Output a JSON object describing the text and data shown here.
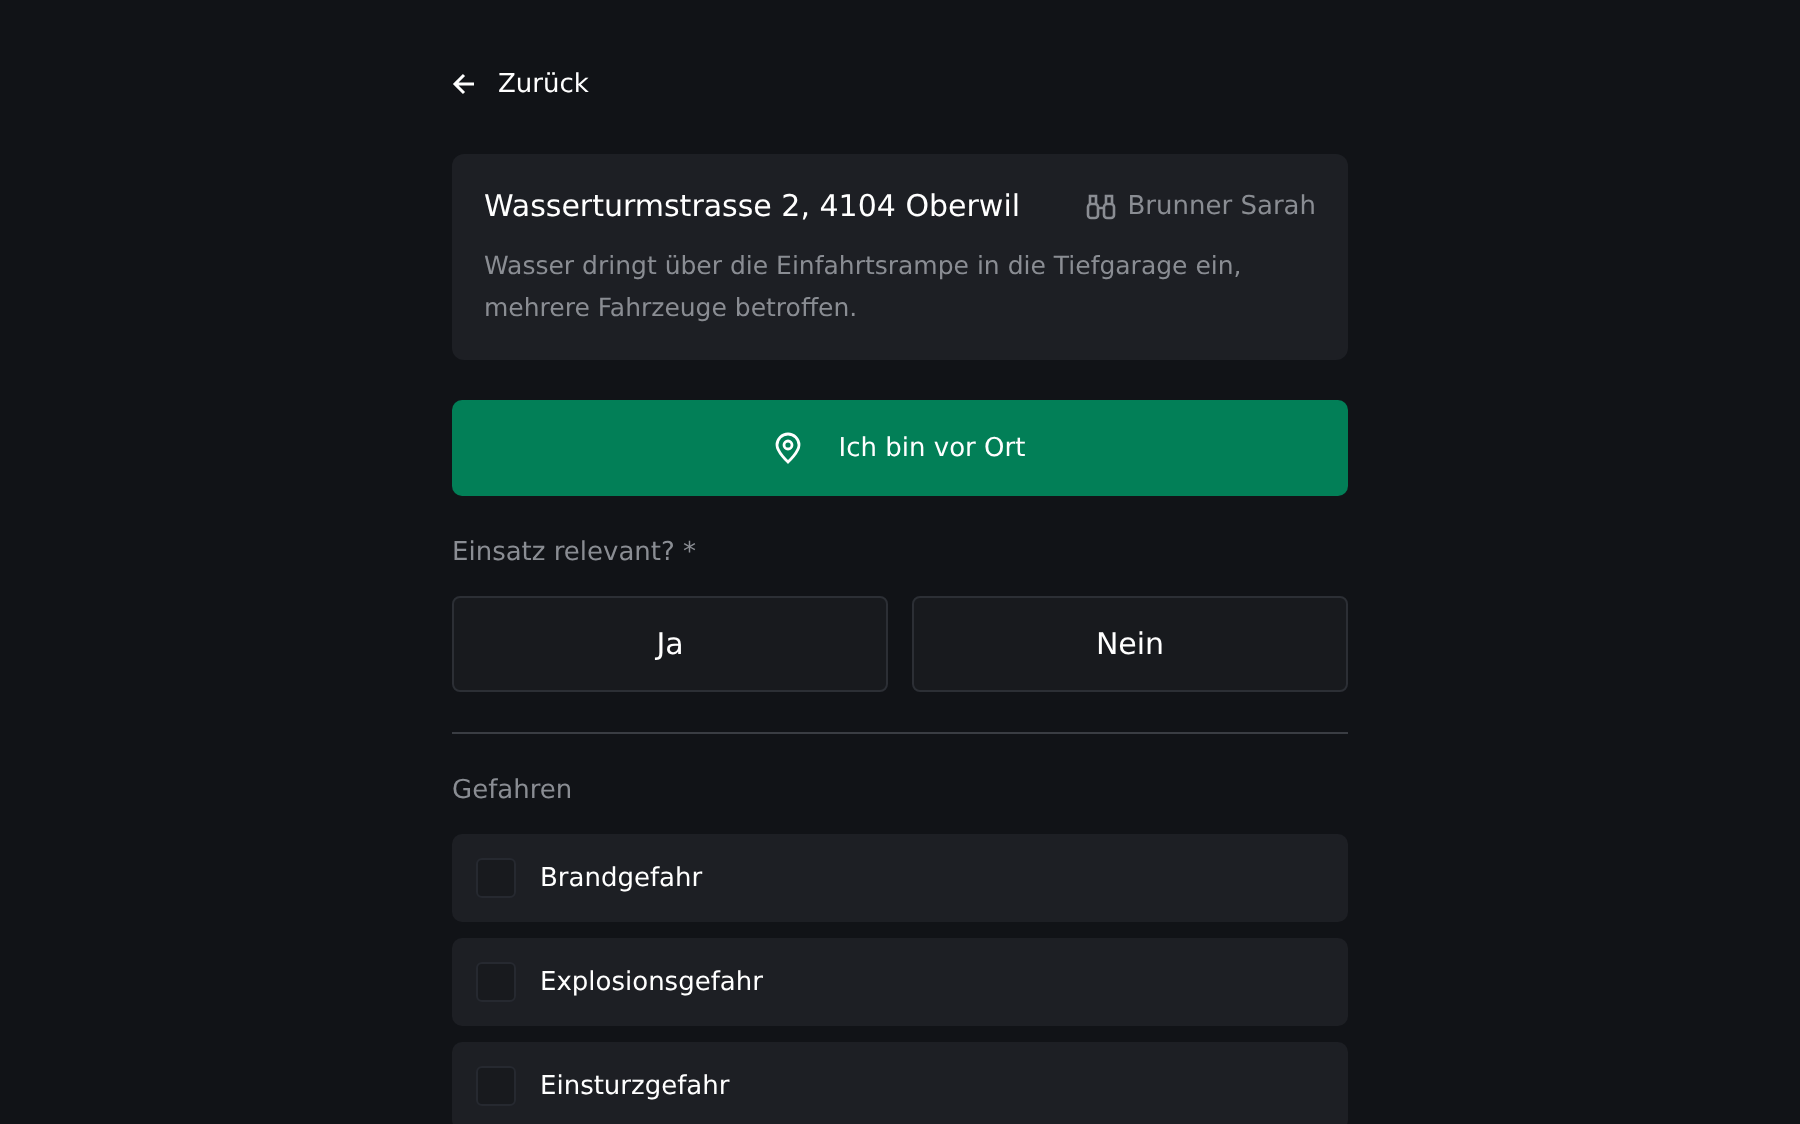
{
  "back": {
    "label": "Zurück"
  },
  "incident": {
    "address": "Wasserturmstrasse 2, 4104 Oberwil",
    "assignee": "Brunner Sarah",
    "description": "Wasser dringt über die Einfahrtsrampe in die Tiefgarage ein, mehrere Fahrzeuge betroffen."
  },
  "arrive_button": {
    "label": "Ich bin vor Ort"
  },
  "relevance": {
    "label": "Einsatz relevant? *",
    "options": [
      {
        "label": "Ja",
        "selected": false
      },
      {
        "label": "Nein",
        "selected": false
      }
    ]
  },
  "hazards": {
    "title": "Gefahren",
    "items": [
      {
        "label": "Brandgefahr",
        "checked": false
      },
      {
        "label": "Explosionsgefahr",
        "checked": false
      },
      {
        "label": "Einsturzgefahr",
        "checked": false
      }
    ]
  }
}
